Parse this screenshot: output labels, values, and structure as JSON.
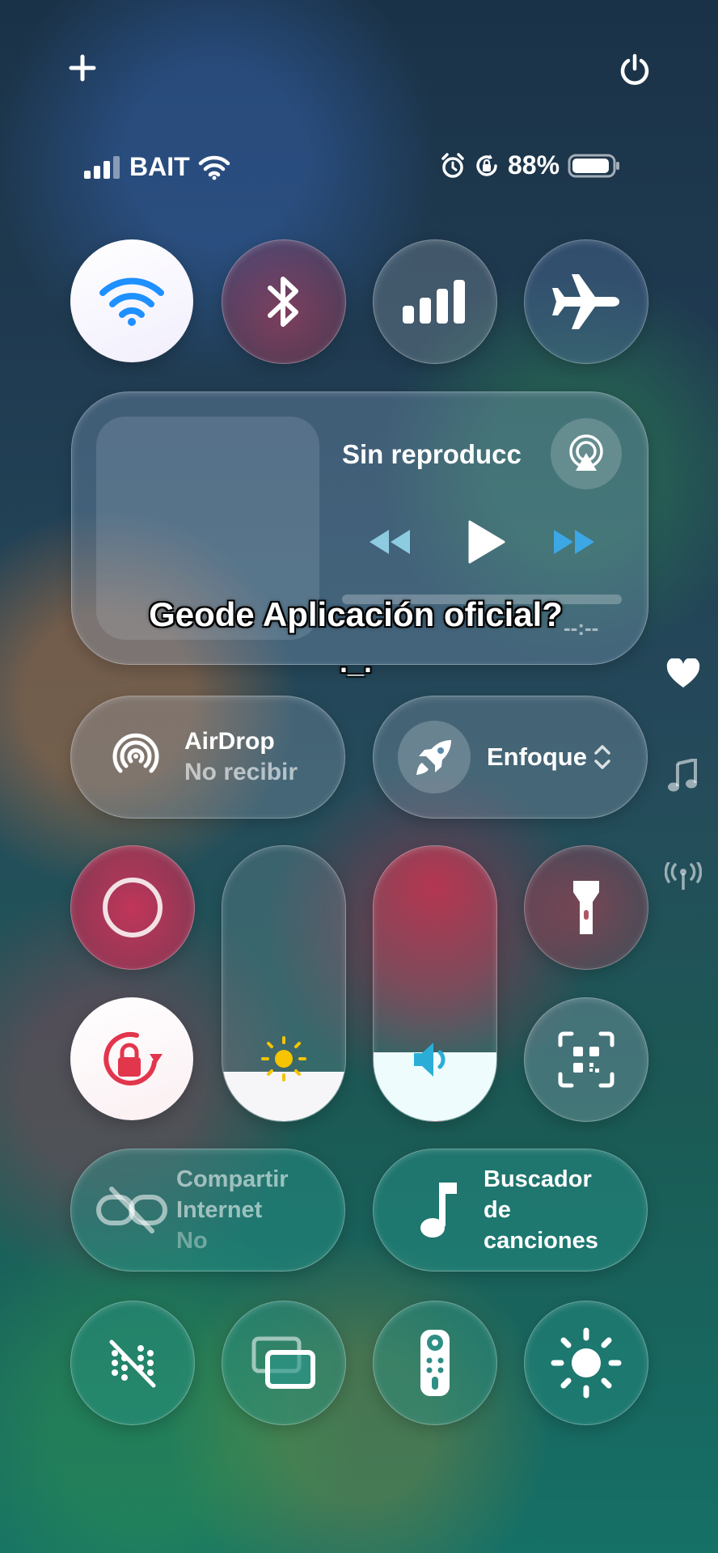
{
  "status_bar": {
    "carrier": "BAIT",
    "battery_percent": "88%"
  },
  "media": {
    "title": "Sin reproducc",
    "time": "--:--"
  },
  "overlay_caption": {
    "line1": "Geode Aplicación oficial?",
    "line2": "._."
  },
  "airdrop": {
    "title": "AirDrop",
    "subtitle": "No recibir"
  },
  "focus": {
    "label": "Enfoque"
  },
  "hotspot": {
    "line1": "Compartir",
    "line2": "Internet",
    "line3": "No"
  },
  "shazam": {
    "line1": "Buscador",
    "line2": "de",
    "line3": "canciones"
  },
  "sliders": {
    "brightness_level": 0.18,
    "volume_level": 0.25
  },
  "colors": {
    "accent_blue": "#1e90ff",
    "record_red": "#d8385f",
    "lock_red": "#e2364d"
  },
  "icons": {
    "add": "plus-icon",
    "power": "power-icon",
    "wifi": "wifi-icon",
    "bluetooth": "bluetooth-icon",
    "cellular": "cellular-icon",
    "airplane": "airplane-icon"
  }
}
